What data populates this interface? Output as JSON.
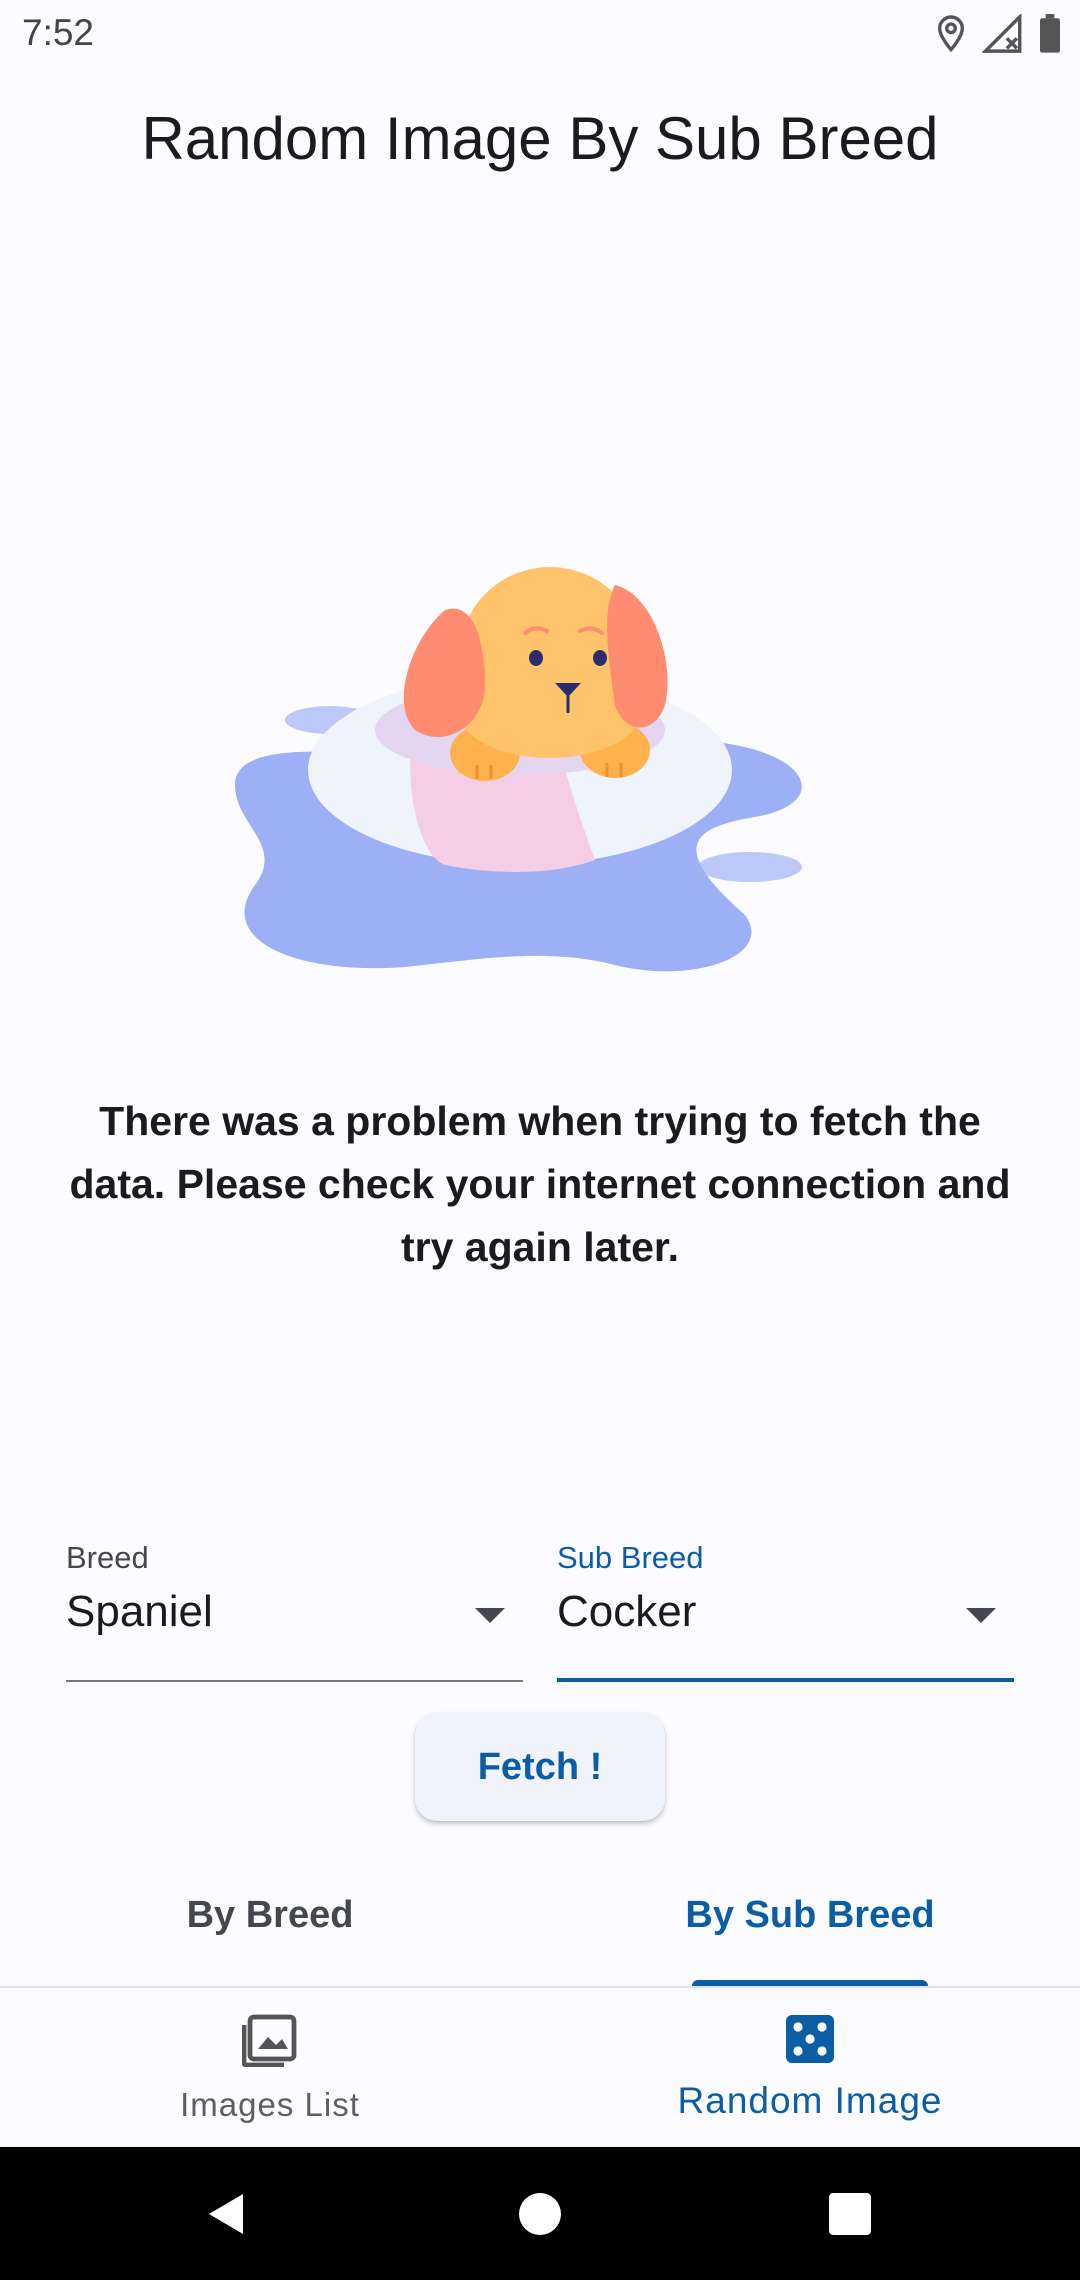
{
  "status_bar": {
    "time": "7:52",
    "icons": [
      "location-icon",
      "signal-off-icon",
      "battery-icon"
    ]
  },
  "title": "Random Image By Sub Breed",
  "illustration": {
    "name": "sad-dog-on-float-illustration",
    "colors": {
      "puddle": "#9db0f5",
      "float": "#eef3fc",
      "float_stripe": "#f4cde6",
      "dog": "#ffc46b",
      "ears": "#ff8b71"
    }
  },
  "error_message": "There was a problem when trying to fetch the data. Please check your internet connection and try again later.",
  "form": {
    "breed": {
      "label": "Breed",
      "value": "Spaniel"
    },
    "sub_breed": {
      "label": "Sub Breed",
      "value": "Cocker"
    },
    "fetch_label": "Fetch !"
  },
  "tabs": [
    {
      "label": "By Breed",
      "selected": false
    },
    {
      "label": "By Sub Breed",
      "selected": true
    }
  ],
  "bottom_nav": [
    {
      "label": "Images List",
      "icon": "photo-library-icon",
      "selected": false
    },
    {
      "label": "Random Image",
      "icon": "dice-icon",
      "selected": true
    }
  ],
  "system_nav": [
    "back-icon",
    "home-icon",
    "recents-icon"
  ],
  "colors": {
    "accent": "#0b5ea5",
    "background": "#fcfbff",
    "button_bg": "#f0f3fa"
  }
}
